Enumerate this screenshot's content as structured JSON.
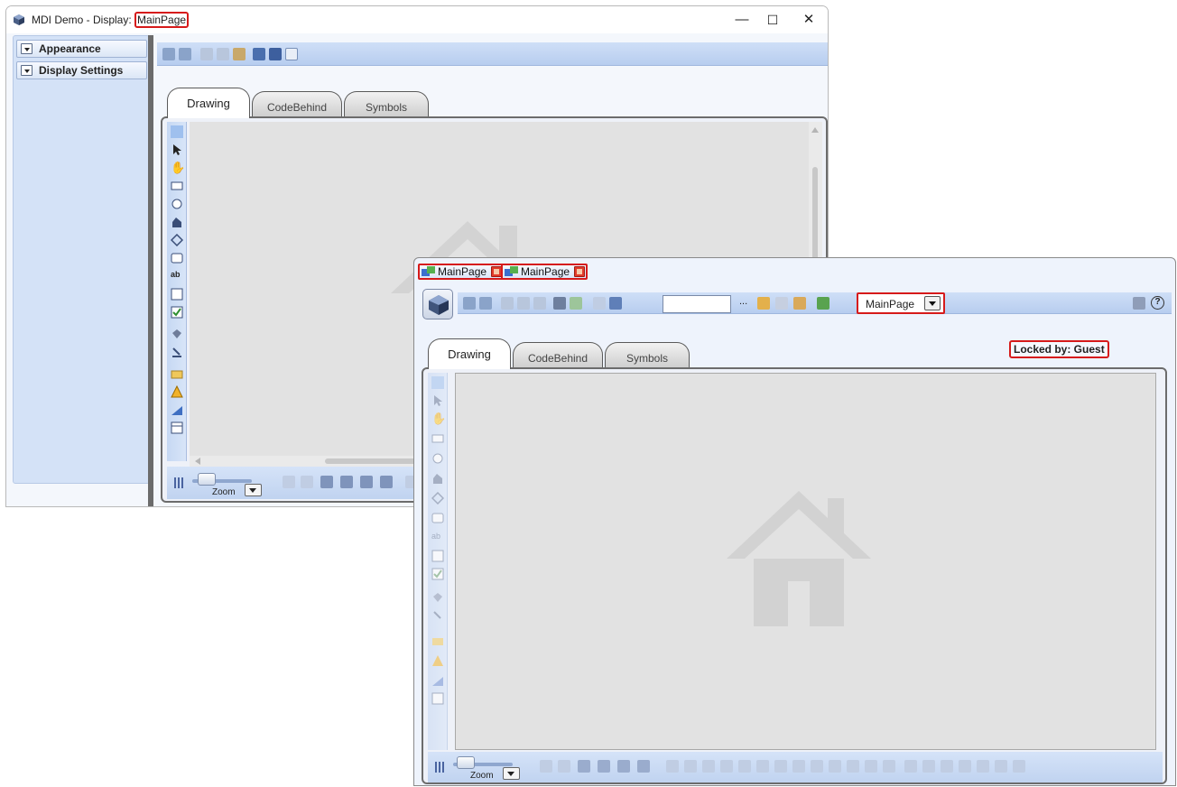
{
  "window_back": {
    "title_prefix": "MDI Demo - Display: ",
    "title_display": "MainPage",
    "controls": {
      "minimize": "—",
      "maximize": "☐",
      "close": "✕"
    },
    "panel_sections": [
      {
        "label": "Appearance"
      },
      {
        "label": "Display Settings"
      }
    ],
    "tabs": [
      {
        "label": "Drawing",
        "active": true
      },
      {
        "label": "CodeBehind",
        "active": false
      },
      {
        "label": "Symbols",
        "active": false
      }
    ],
    "zoom_label": "Zoom"
  },
  "window_front": {
    "doc_tabs": [
      {
        "label": "MainPage"
      },
      {
        "label": "MainPage"
      }
    ],
    "display_select": {
      "value": "MainPage"
    },
    "search": {
      "value": ""
    },
    "ellipsis": "...",
    "locked_label": "Locked by: Guest",
    "tabs": [
      {
        "label": "Drawing",
        "active": true
      },
      {
        "label": "CodeBehind",
        "active": false
      },
      {
        "label": "Symbols",
        "active": false
      }
    ],
    "zoom_label": "Zoom"
  },
  "colors": {
    "accent_red": "#d61a1a",
    "toolbar_blue": "#c3d6f3",
    "canvas_gray": "#e2e2e2"
  }
}
